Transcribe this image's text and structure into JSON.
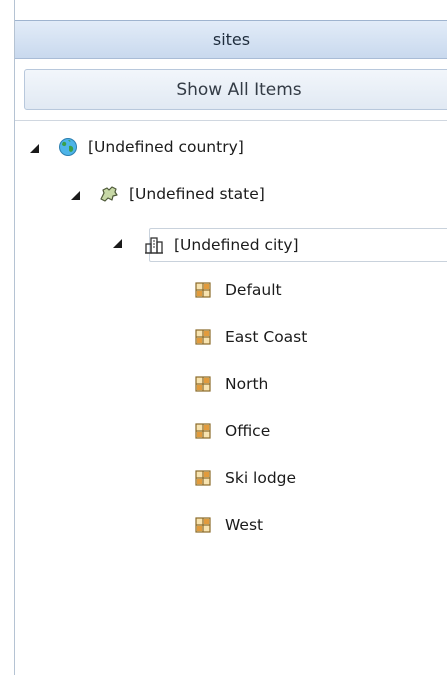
{
  "panel": {
    "title": "sites",
    "show_all_label": "Show All Items"
  },
  "tree": {
    "country": {
      "label": "[Undefined country]",
      "icon": "globe-icon",
      "expanded": true
    },
    "state": {
      "label": "[Undefined state]",
      "icon": "map-state-icon",
      "expanded": true
    },
    "city": {
      "label": "[Undefined city]",
      "icon": "buildings-icon",
      "expanded": true,
      "selected": true
    },
    "sites": [
      {
        "label": "Default",
        "icon": "site-grid-icon"
      },
      {
        "label": "East Coast",
        "icon": "site-grid-icon"
      },
      {
        "label": "North",
        "icon": "site-grid-icon"
      },
      {
        "label": "Office",
        "icon": "site-grid-icon"
      },
      {
        "label": "Ski lodge",
        "icon": "site-grid-icon"
      },
      {
        "label": "West",
        "icon": "site-grid-icon"
      }
    ]
  },
  "colors": {
    "header_bg": "#c9d9ee",
    "button_bg": "#e1e9f3",
    "globe": "#3aa04a",
    "site_icon": "#c58b2c"
  }
}
